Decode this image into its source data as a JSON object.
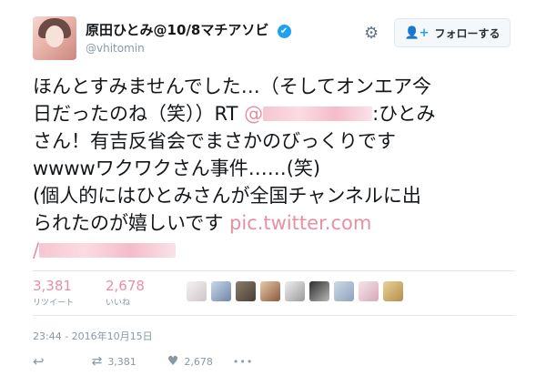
{
  "user": {
    "display_name": "原田ひとみ@10/8マチアソビ",
    "handle": "@vhitomin",
    "verified_icon": "✔"
  },
  "header": {
    "gear_icon": "⚙",
    "follow_icon": "👤+",
    "follow_label": "フォローする"
  },
  "tweet": {
    "line1": "ほんとすみませんでした…（そしてオンエア今",
    "line2_a": "日だったのね（笑））RT ",
    "mention_prefix": "@",
    "line2_b": ":ひとみ",
    "line3": "さん！有吉反省会でまさかのびっくりです",
    "line4": "wwwwワクワクさん事件……(笑)",
    "line5": "(個人的にはひとみさんが全国チャンネルに出",
    "line6": "られたのが嬉しいです ",
    "link": "pic.twitter.com",
    "link_slash": "/"
  },
  "stats": {
    "retweets": "3,381",
    "retweets_label": "リツイート",
    "likes": "2,678",
    "likes_label": "いいね"
  },
  "timestamp": "23:44 - 2016年10月15日",
  "actions": {
    "reply_icon": "↩",
    "retweet_icon": "⇄",
    "retweet_count": "3,381",
    "like_icon": "♥",
    "like_count": "2,678",
    "more_icon": "•••"
  },
  "colors": {
    "link": "#e88fa3",
    "muted": "#8899a6",
    "verified": "#1da1f2"
  }
}
